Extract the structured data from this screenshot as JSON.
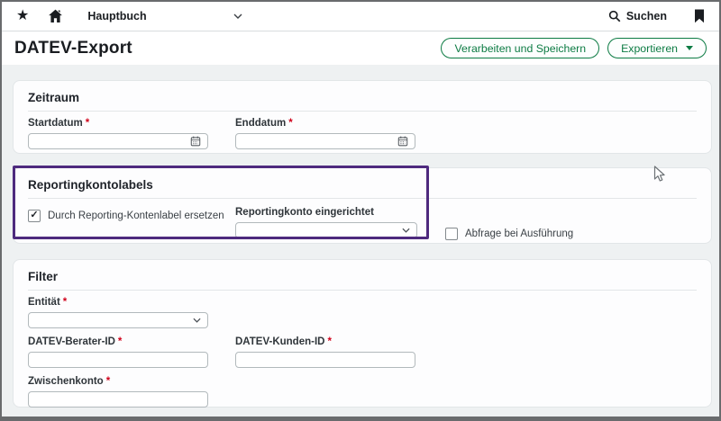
{
  "topbar": {
    "module_selector": "Hauptbuch",
    "search_label": "Suchen"
  },
  "header": {
    "title": "DATEV-Export",
    "process_save_button": "Verarbeiten und Speichern",
    "export_button": "Exportieren"
  },
  "required_marker": "*",
  "check_glyph": "✓",
  "zeitraum": {
    "title": "Zeitraum",
    "startdatum": {
      "label": "Startdatum",
      "required": true,
      "value": ""
    },
    "enddatum": {
      "label": "Enddatum",
      "required": true,
      "value": ""
    }
  },
  "reporting": {
    "title": "Reportingkontolabels",
    "replace_checkbox": {
      "label": "Durch Reporting-Kontenlabel ersetzen",
      "checked": true
    },
    "reportingkonto_select": {
      "label": "Reportingkonto eingerichtet",
      "value": ""
    },
    "abfrage_checkbox": {
      "label": "Abfrage bei Ausführung",
      "checked": false
    }
  },
  "filter": {
    "title": "Filter",
    "entitaet": {
      "label": "Entität",
      "required": true,
      "value": ""
    },
    "berater_id": {
      "label": "DATEV-Berater-ID",
      "required": true,
      "value": ""
    },
    "kunden_id": {
      "label": "DATEV-Kunden-ID",
      "required": true,
      "value": ""
    },
    "zwischenkonto": {
      "label": "Zwischenkonto",
      "required": true,
      "value": ""
    }
  },
  "colors": {
    "accent_green": "#0c7b43",
    "highlight_purple": "#4e2a7e",
    "required_red": "#d0021b",
    "frame_border": "#696b6d"
  },
  "icons": [
    "star-icon",
    "home-icon",
    "chevron-down-icon",
    "search-icon",
    "bookmark-icon",
    "calendar-icon",
    "caret-down-icon",
    "check-icon",
    "cursor-icon"
  ]
}
